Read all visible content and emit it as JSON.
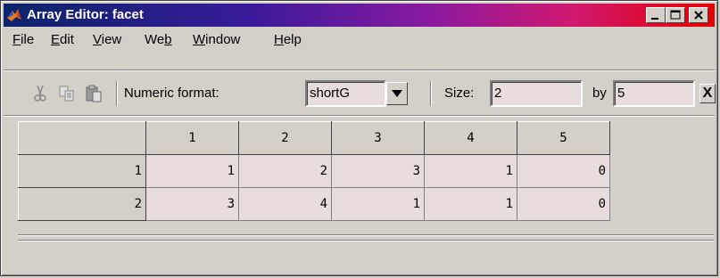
{
  "window": {
    "title": "Array Editor: facet"
  },
  "menu": [
    {
      "pre": "",
      "ul": "F",
      "post": "ile"
    },
    {
      "pre": "",
      "ul": "E",
      "post": "dit"
    },
    {
      "pre": "",
      "ul": "V",
      "post": "iew"
    },
    {
      "pre": "We",
      "ul": "b",
      "post": ""
    },
    {
      "pre": "",
      "ul": "W",
      "post": "indow"
    },
    {
      "pre": "",
      "ul": "H",
      "post": "elp"
    }
  ],
  "toolbar": {
    "numeric_format_label": "Numeric format:",
    "numeric_format_value": "shortG",
    "size_label": "Size:",
    "rows_value": "2",
    "by_label": "by",
    "cols_value": "5",
    "close_label": "X"
  },
  "grid": {
    "col_headers": [
      "1",
      "2",
      "3",
      "4",
      "5"
    ],
    "rows": [
      {
        "header": "1",
        "values": [
          "1",
          "2",
          "3",
          "1",
          "0"
        ]
      },
      {
        "header": "2",
        "values": [
          "3",
          "4",
          "1",
          "1",
          "0"
        ]
      }
    ]
  }
}
